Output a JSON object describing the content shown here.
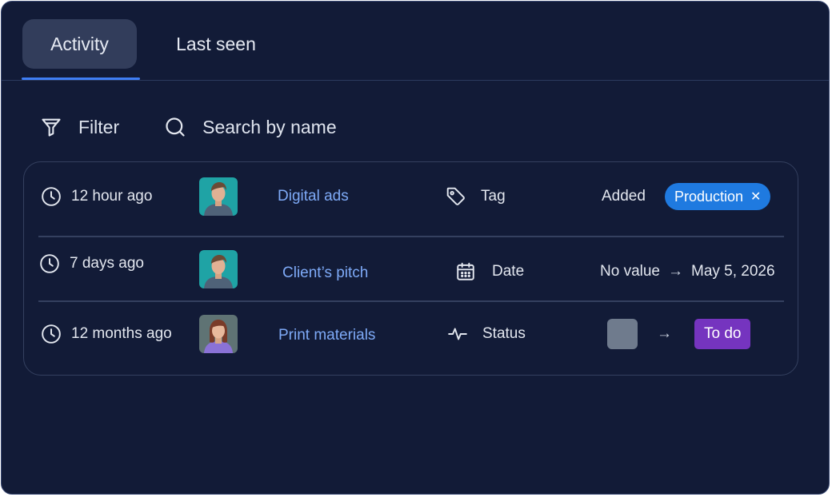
{
  "tabs": [
    {
      "label": "Activity",
      "active": true
    },
    {
      "label": "Last seen",
      "active": false
    }
  ],
  "toolbar": {
    "filter_label": "Filter",
    "search_placeholder": "Search by name"
  },
  "rows": [
    {
      "time": "12 hour ago",
      "avatar": "man-avatar",
      "item": "Digital ads",
      "property": "Tag",
      "property_icon": "tag-icon",
      "action": "Added",
      "tag": "Production"
    },
    {
      "time": "7 days ago",
      "avatar": "man-avatar",
      "item": "Client’s pitch",
      "property": "Date",
      "property_icon": "calendar-icon",
      "old_value": "No value",
      "new_value": "May 5, 2026"
    },
    {
      "time": "12 months ago",
      "avatar": "woman-avatar",
      "item": "Print materials",
      "property": "Status",
      "property_icon": "activity-icon",
      "new_value": "To do"
    }
  ],
  "colors": {
    "background": "#121b37",
    "accent": "#3f7ef5",
    "link": "#7eaaf7",
    "tag_chip": "#1f7ae0",
    "status_old": "#6f7b8d",
    "status_todo": "#7534bf"
  }
}
